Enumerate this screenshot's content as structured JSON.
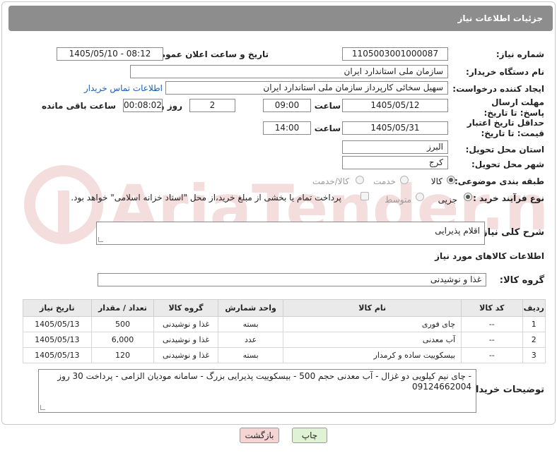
{
  "header": {
    "title": "جزئیات اطلاعات نیاز"
  },
  "form": {
    "need_number_label": "شماره نیاز:",
    "need_number": "1105003001000087",
    "announce_label": "تاریخ و ساعت اعلان عمومی:",
    "announce_value": "1405/05/10 - 08:12",
    "buyer_org_label": "نام دستگاه خریدار:",
    "buyer_org": "سازمان ملی استاندارد ایران",
    "creator_label": "ایجاد کننده درخواست:",
    "creator": "سهیل سخائی کارپرداز سازمان ملی استاندارد ایران",
    "buyer_contact_link": "اطلاعات تماس خریدار",
    "reply_deadline_label": "مهلت ارسال پاسخ: تا تاریخ:",
    "reply_date": "1405/05/12",
    "time_word": "ساعت",
    "reply_time": "09:00",
    "days": "2",
    "day_and": "روز و",
    "remaining": "00:08:02",
    "remaining_label": "ساعت باقی مانده",
    "price_validity_label": "حداقل تاریخ اعتبار قیمت: تا تاریخ:",
    "price_date": "1405/05/31",
    "price_time": "14:00",
    "province_label": "استان محل تحویل:",
    "province": "البرز",
    "city_label": "شهر محل تحویل:",
    "city": "کرج",
    "category_label": "طبقه بندی موضوعی:",
    "category_options": [
      "کالا",
      "خدمت",
      "کالا/خدمت"
    ],
    "process_label": "نوع فرآیند خرید :",
    "process_options": [
      "جزیی",
      "متوسط"
    ],
    "payment_note": "پرداخت تمام یا بخشی از مبلغ خرید،از محل \"اسناد خزانه اسلامی\" خواهد بود."
  },
  "description": {
    "label": "شرح کلی نیاز:",
    "value": "اقلام پذیرایی"
  },
  "goods_info_title": "اطلاعات کالاهای مورد نیاز",
  "goods_group": {
    "label": "گروه کالا:",
    "value": "غذا و نوشیدنی"
  },
  "table": {
    "headers": [
      "ردیف",
      "کد کالا",
      "نام کالا",
      "واحد شمارش",
      "گروه کالا",
      "تعداد / مقدار",
      "تاریخ نیاز"
    ],
    "rows": [
      [
        "1",
        "--",
        "چای فوری",
        "بسته",
        "غذا و نوشیدنی",
        "500",
        "1405/05/13"
      ],
      [
        "2",
        "--",
        "آب معدنی",
        "عدد",
        "غذا و نوشیدنی",
        "6,000",
        "1405/05/13"
      ],
      [
        "3",
        "--",
        "بیسکوییت ساده و کرمدار",
        "بسته",
        "غذا و نوشیدنی",
        "120",
        "1405/05/13"
      ]
    ]
  },
  "buyer_notes": {
    "label": "توضیحات خریدار:",
    "value": "- چای نیم کیلویی دو غزال - آب معدنی حجم 500   - بیسکوییت پذیرایی  بزرگ - سامانه مودیان الزامی - پرداخت 30 روز 09124662004"
  },
  "buttons": {
    "print": "چاپ",
    "back": "بازگشت"
  },
  "colors": {
    "header_bg": "#8d8d8d",
    "back_button_bg": "#f6d4d4",
    "print_button_bg": "#dff3d4",
    "link": "#1a5fb4"
  }
}
